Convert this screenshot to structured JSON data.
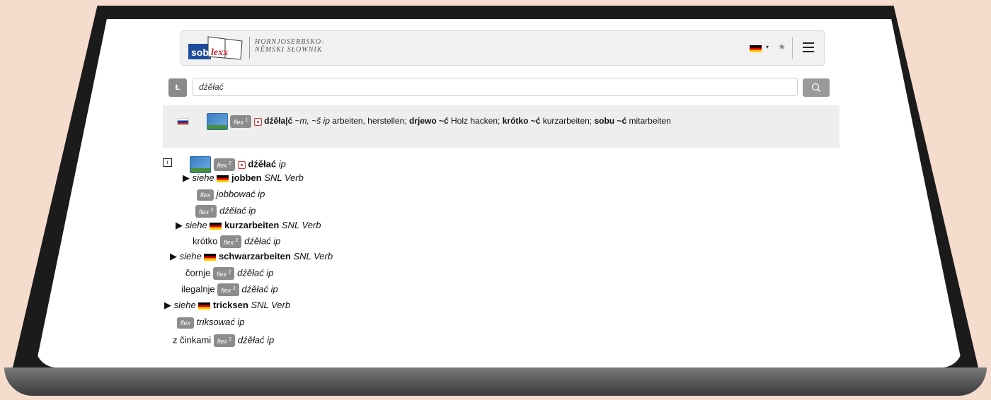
{
  "app": {
    "logo_text": "soblexx",
    "subtitle_line1": "HORNJOSERBSKO-",
    "subtitle_line2": "NĚMSKI SŁOWNIK",
    "lang_icon": "de-flag-icon",
    "caret": "▾",
    "star": "★"
  },
  "search": {
    "kbd_label": "Ł",
    "value": "dźěłać"
  },
  "result": {
    "flex_label": "flex",
    "flex_sup": "1",
    "headword": "dźěła|ć",
    "gram": "~m, ~š ip",
    "trans1": " arbeiten, herstellen; ",
    "phrase1": "drjewo ~ć",
    "trans2": " Holz hacken; ",
    "phrase2": "krótko ~ć",
    "trans3": " kurzarbeiten; ",
    "phrase3": "sobu ~ć",
    "trans4": " mitarbeiten"
  },
  "tree": {
    "info": "i",
    "head": {
      "flex": "flex",
      "sup": "2",
      "word": "dźěłać",
      "pos": "ip"
    },
    "items": [
      {
        "type": "siehe",
        "arrow": "▶",
        "siehe": "siehe",
        "word": "jobben",
        "tag": "SNL Verb"
      },
      {
        "type": "flex",
        "flex": "flex",
        "sup": "",
        "text": "jobbować ip"
      },
      {
        "type": "flex",
        "flex": "flex",
        "sup": "2",
        "text": "dźěłać ip"
      },
      {
        "type": "siehe",
        "arrow": "▶",
        "siehe": "siehe",
        "word": "kurzarbeiten",
        "tag": "SNL Verb"
      },
      {
        "type": "prefix",
        "prefix": "krótko",
        "flex": "flex",
        "sup": "2",
        "text": "dźěłać ip"
      },
      {
        "type": "siehe",
        "arrow": "▶",
        "siehe": "siehe",
        "word": "schwarzarbeiten",
        "tag": "SNL Verb"
      },
      {
        "type": "prefix",
        "prefix": "čornje",
        "flex": "flex",
        "sup": "2",
        "text": "dźěłać ip"
      },
      {
        "type": "prefix",
        "prefix": "ilegalnje",
        "flex": "flex",
        "sup": "2",
        "text": "dźěłać ip"
      },
      {
        "type": "siehe",
        "arrow": "▶",
        "siehe": "siehe",
        "word": "tricksen",
        "tag": "SNL Verb"
      },
      {
        "type": "flex",
        "flex": "flex",
        "sup": "",
        "text": "triksować ip"
      },
      {
        "type": "prefix",
        "prefix": "z činkami",
        "flex": "flex",
        "sup": "2",
        "text": "dźěłać ip"
      }
    ]
  },
  "colors": {
    "background": "#f6dccc",
    "badge": "#8c8c8c",
    "band": "#eeeeee"
  }
}
